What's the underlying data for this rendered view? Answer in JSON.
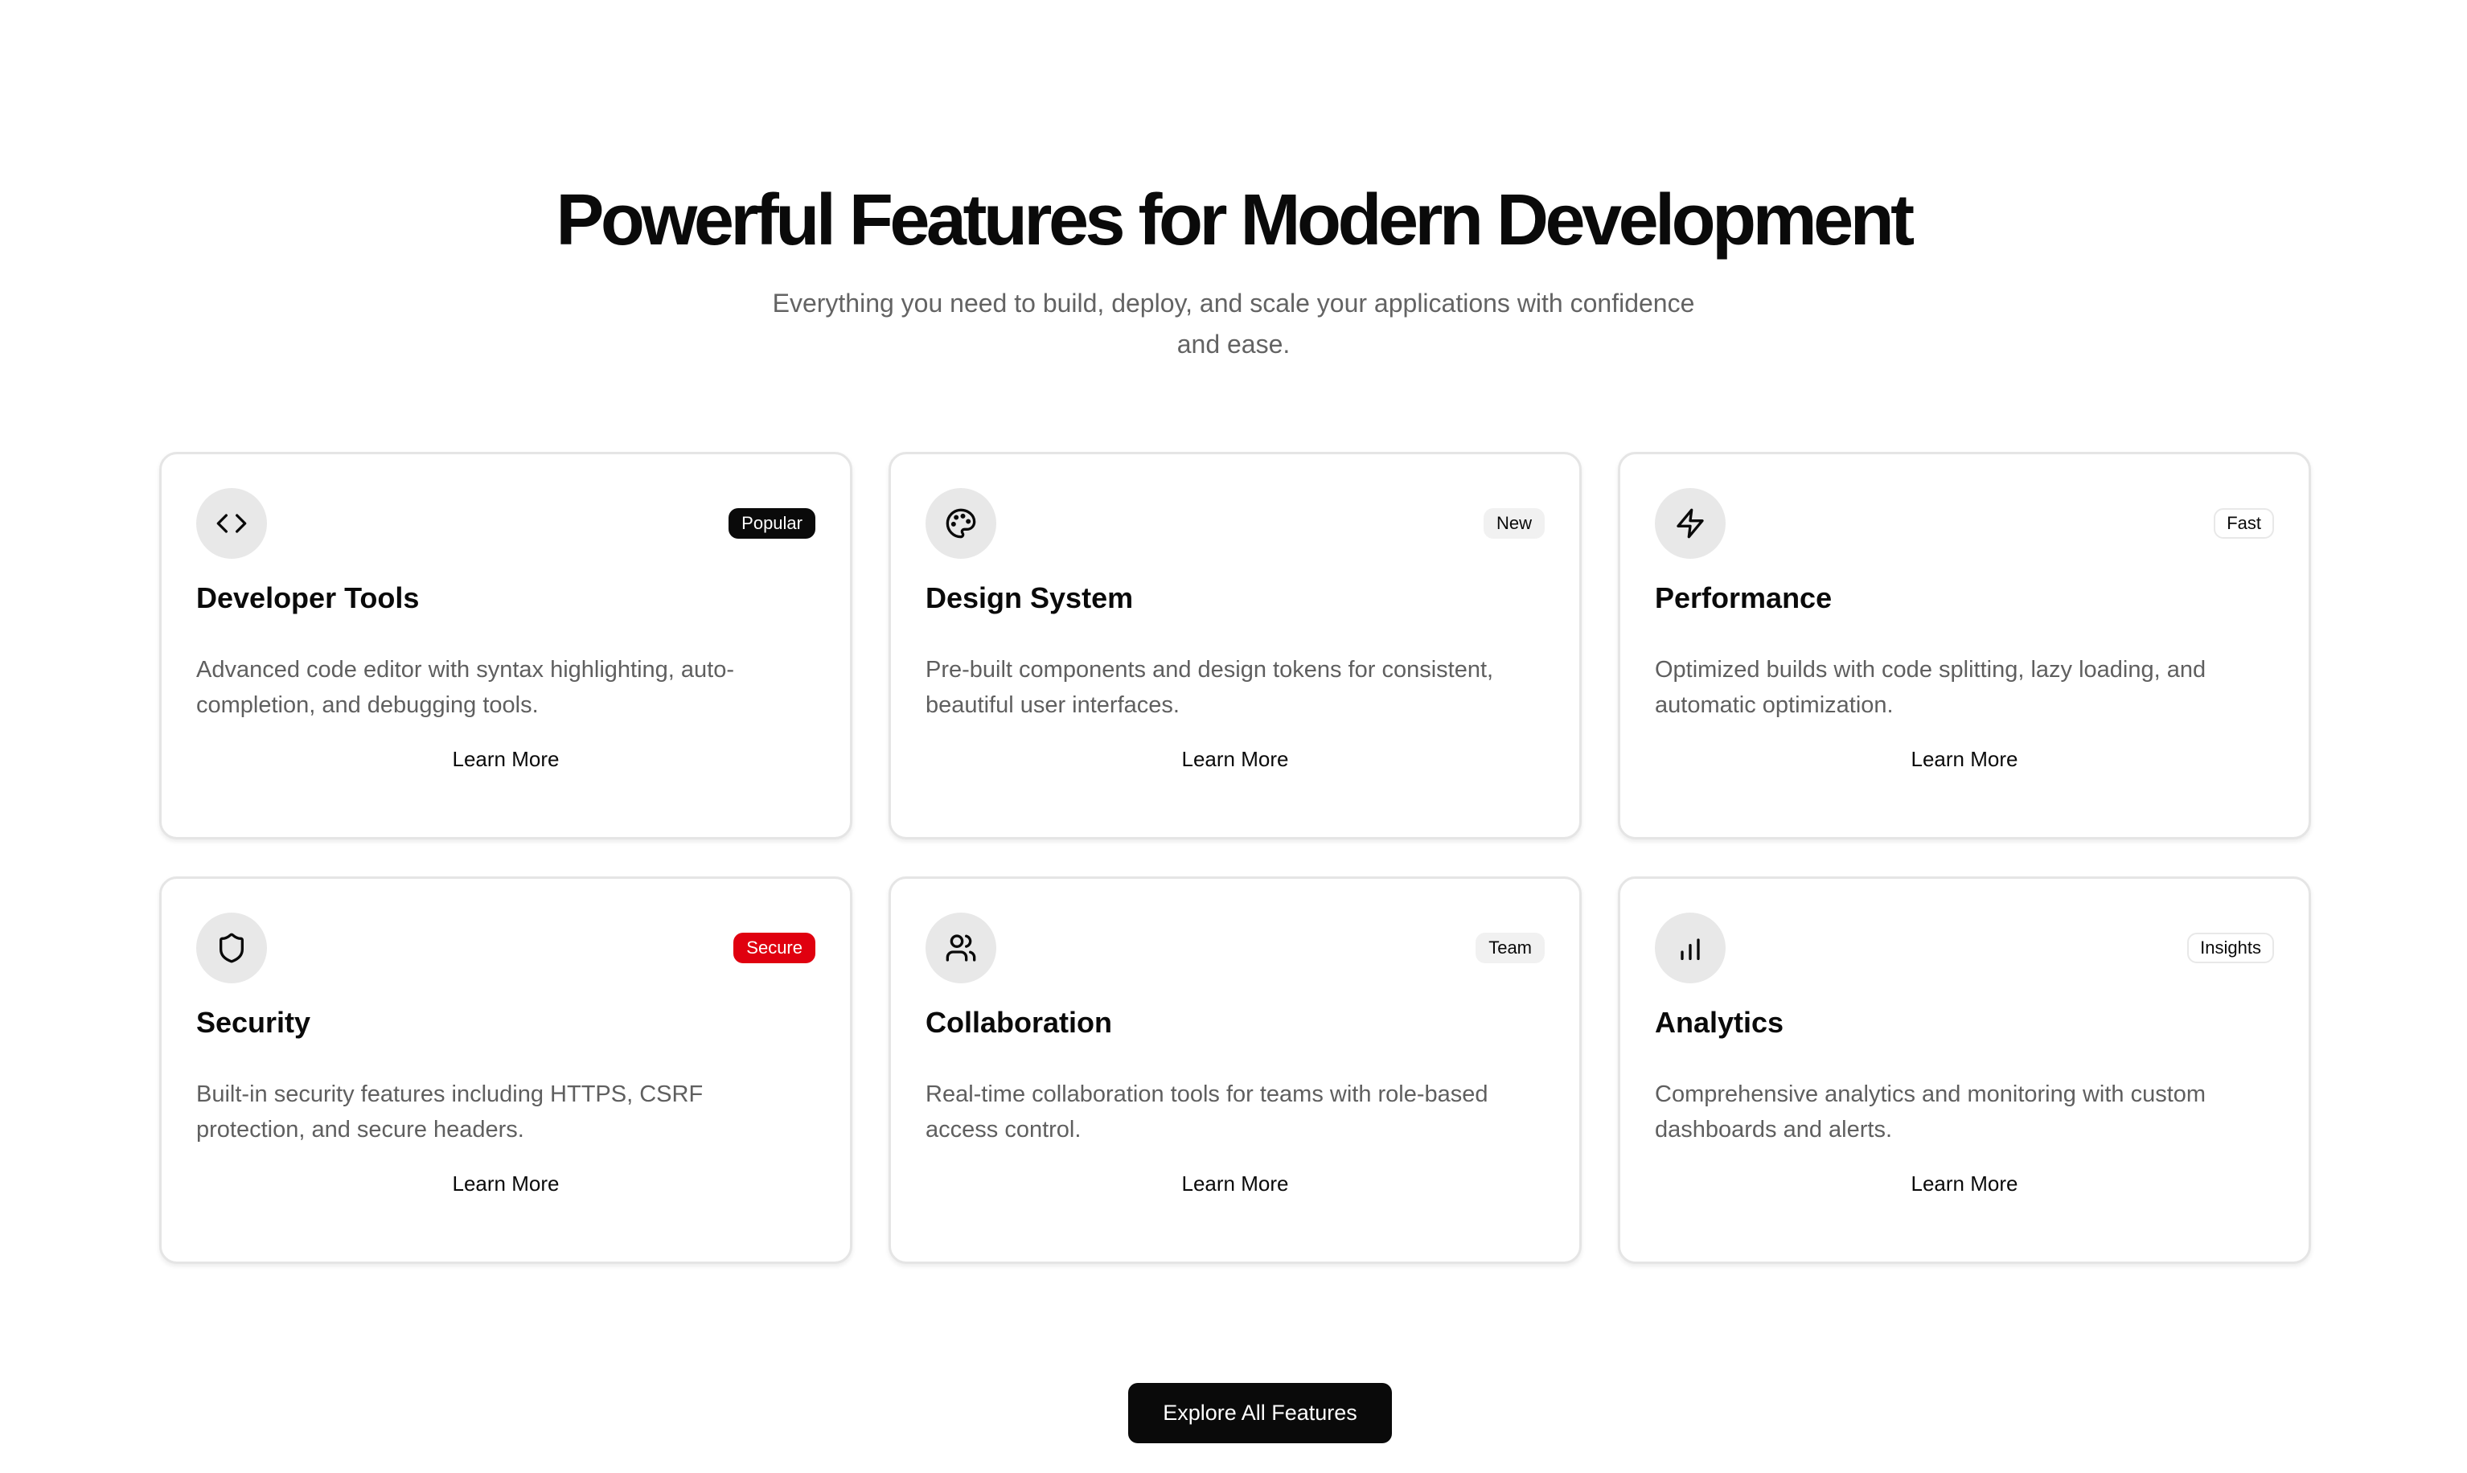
{
  "hero": {
    "title": "Powerful Features for Modern Development",
    "subtitle": "Everything you need to build, deploy, and scale your applications with confidence and ease."
  },
  "cards": [
    {
      "icon": "code-icon",
      "badge": "Popular",
      "badge_style": "dark",
      "title": "Developer Tools",
      "description": "Advanced code editor with syntax highlighting, auto-completion, and debugging tools.",
      "link": "Learn More"
    },
    {
      "icon": "palette-icon",
      "badge": "New",
      "badge_style": "soft",
      "title": "Design System",
      "description": "Pre-built components and design tokens for consistent, beautiful user interfaces.",
      "link": "Learn More"
    },
    {
      "icon": "lightning-icon",
      "badge": "Fast",
      "badge_style": "outline",
      "title": "Performance",
      "description": "Optimized builds with code splitting, lazy loading, and automatic optimization.",
      "link": "Learn More"
    },
    {
      "icon": "shield-icon",
      "badge": "Secure",
      "badge_style": "red",
      "title": "Security",
      "description": "Built-in security features including HTTPS, CSRF protection, and secure headers.",
      "link": "Learn More"
    },
    {
      "icon": "users-icon",
      "badge": "Team",
      "badge_style": "soft",
      "title": "Collaboration",
      "description": "Real-time collaboration tools for teams with role-based access control.",
      "link": "Learn More"
    },
    {
      "icon": "bar-chart-icon",
      "badge": "Insights",
      "badge_style": "outline",
      "title": "Analytics",
      "description": "Comprehensive analytics and monitoring with custom dashboards and alerts.",
      "link": "Learn More"
    }
  ],
  "cta": {
    "label": "Explore All Features"
  },
  "colors": {
    "text": "#0a0a0a",
    "muted": "#636363",
    "badge_red": "#e0000f",
    "icon_bg": "#e8e8e8",
    "card_border": "#e5e5e5"
  }
}
